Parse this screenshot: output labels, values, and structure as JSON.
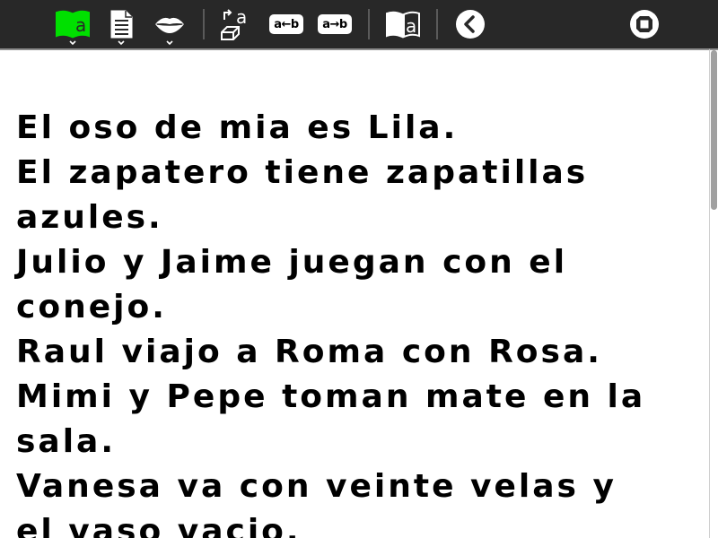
{
  "toolbar": {
    "buttons": [
      {
        "name": "read-activity",
        "icon": "book-letter-a-icon",
        "color": "#00e000"
      },
      {
        "name": "document",
        "icon": "document-icon"
      },
      {
        "name": "speak",
        "icon": "lips-icon"
      },
      {
        "name": "erase",
        "icon": "eraser-a-icon"
      },
      {
        "name": "translate-ba",
        "label": "a←b"
      },
      {
        "name": "translate-ab",
        "label": "a→b"
      },
      {
        "name": "dictionary",
        "icon": "book-a-icon"
      },
      {
        "name": "back",
        "icon": "back-circle-icon"
      },
      {
        "name": "stop",
        "icon": "stop-icon"
      }
    ]
  },
  "content": {
    "lines": [
      "El oso de mia es Lila.",
      "El zapatero tiene zapatillas",
      "azules.",
      "Julio y Jaime juegan con el",
      "conejo.",
      "Raul viajo a Roma con Rosa.",
      "Mimi y Pepe toman mate en la",
      "sala.",
      "Vanesa va con veinte velas y",
      "el vaso vacio."
    ]
  },
  "colors": {
    "toolbar_bg": "#282828",
    "accent_green": "#00e000",
    "text": "#000000",
    "page_bg": "#ffffff"
  }
}
